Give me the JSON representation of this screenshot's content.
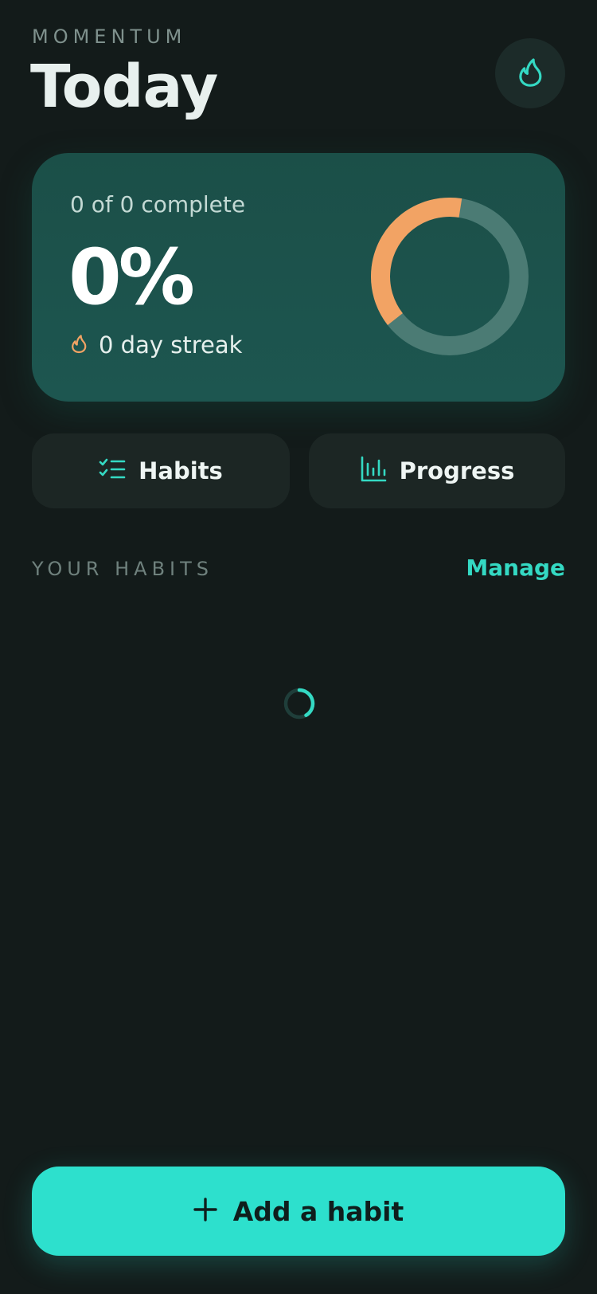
{
  "header": {
    "brand": "MOMENTUM",
    "title": "Today",
    "streak_icon": "flame-icon"
  },
  "summary": {
    "complete_text": "0 of 0 complete",
    "percent_text": "0%",
    "streak_text": "0 day streak",
    "streak_icon": "flame-icon",
    "ring_fill_fraction": 0.38,
    "colors": {
      "ring_fill": "#f2a364",
      "ring_track": "#4b7b74",
      "card_bg": "#1c534c"
    }
  },
  "tabs": [
    {
      "label": "Habits",
      "icon": "checklist-icon"
    },
    {
      "label": "Progress",
      "icon": "bar-chart-icon"
    }
  ],
  "habits_section": {
    "label": "YOUR HABITS",
    "manage_label": "Manage",
    "loading": true
  },
  "add_button": {
    "label": "Add a habit",
    "icon": "plus-icon"
  },
  "colors": {
    "accent": "#2de0cd",
    "background": "#131b1a"
  }
}
